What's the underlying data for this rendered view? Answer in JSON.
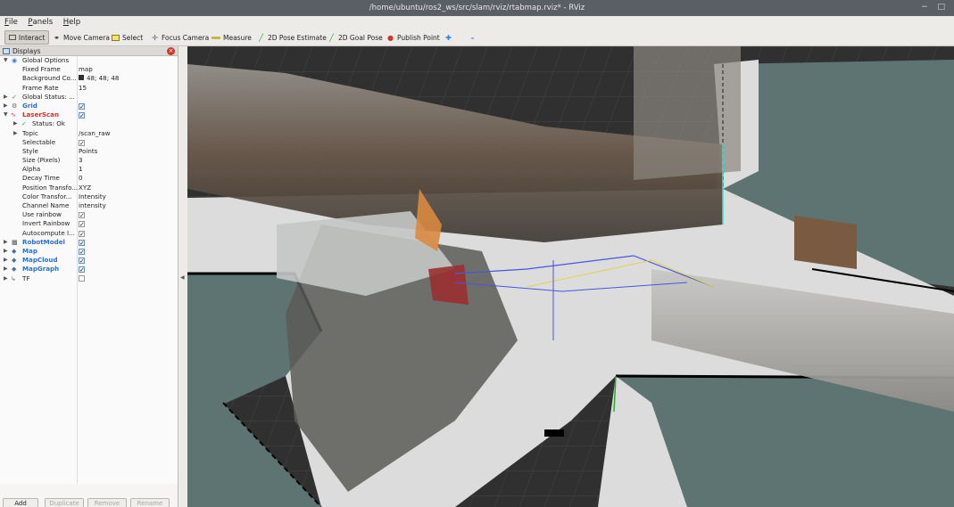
{
  "window": {
    "title": "/home/ubuntu/ros2_ws/src/slam/rviz/rtabmap.rviz* - RViz",
    "controls": "− □"
  },
  "menu": [
    {
      "key": "F",
      "rest": "ile"
    },
    {
      "key": "P",
      "rest": "anels"
    },
    {
      "key": "H",
      "rest": "elp"
    }
  ],
  "toolbar": {
    "interact": "Interact",
    "move_camera": "Move Camera",
    "select": "Select",
    "focus_camera": "Focus Camera",
    "measure": "Measure",
    "pose_estimate": "2D Pose Estimate",
    "goal_pose": "2D Goal Pose",
    "publish_point": "Publish Point"
  },
  "displays": {
    "title": "Displays",
    "global_options": "Global Options",
    "fixed_frame": {
      "label": "Fixed Frame",
      "value": "map"
    },
    "background": {
      "label": "Background Co...",
      "value": "48; 48; 48",
      "color": "#303030"
    },
    "frame_rate": {
      "label": "Frame Rate",
      "value": "15"
    },
    "global_status": "Global Status: ...",
    "grid": "Grid",
    "laserscan": "LaserScan",
    "status_ok": "Status: Ok",
    "props": [
      {
        "label": "Topic",
        "value": "/scan_raw"
      },
      {
        "label": "Selectable",
        "value": "✓"
      },
      {
        "label": "Style",
        "value": "Points"
      },
      {
        "label": "Size (Pixels)",
        "value": "3"
      },
      {
        "label": "Alpha",
        "value": "1"
      },
      {
        "label": "Decay Time",
        "value": "0"
      },
      {
        "label": "Position Transfo...",
        "value": "XYZ"
      },
      {
        "label": "Color Transfor...",
        "value": "Intensity"
      },
      {
        "label": "Channel Name",
        "value": "intensity"
      },
      {
        "label": "Use rainbow",
        "value": "✓"
      },
      {
        "label": "Invert Rainbow",
        "value": "✓"
      },
      {
        "label": "Autocompute I...",
        "value": "✓"
      }
    ],
    "robot_model": "RobotModel",
    "map": "Map",
    "map_cloud": "MapCloud",
    "map_graph": "MapGraph",
    "tf": "TF"
  },
  "buttons": {
    "add": "Add",
    "duplicate": "Duplicate",
    "remove": "Remove",
    "rename": "Rename"
  },
  "colors": {
    "accent": "#2a6fd3",
    "close": "#d6332a",
    "map_free": "#dcdcdc",
    "map_unknown": "#5d7473",
    "map_occupied": "#000000",
    "background": "#303030"
  }
}
